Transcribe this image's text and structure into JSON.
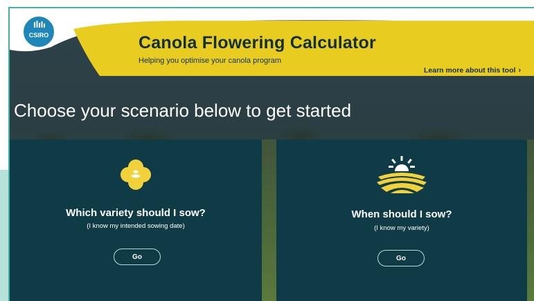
{
  "header": {
    "brand": "CSIRO",
    "title": "Canola Flowering Calculator",
    "subtitle": "Helping you optimise your canola program",
    "learn_more": "Learn more about this tool",
    "learn_more_icon": "chevron-right-icon"
  },
  "main": {
    "headline": "Choose your scenario below to get started"
  },
  "cards": [
    {
      "icon": "canola-flower-icon",
      "question": "Which variety should I sow?",
      "hint": "(I know my intended sowing date)",
      "button": "Go"
    },
    {
      "icon": "sunrise-field-icon",
      "question": "When should I sow?",
      "hint": "(I know my variety)",
      "button": "Go"
    }
  ],
  "colors": {
    "accent_yellow": "#e8cc1f",
    "card_bg": "#0f3b47",
    "logo_blue": "#1e86b8",
    "frame_teal": "#3fb3a3"
  }
}
